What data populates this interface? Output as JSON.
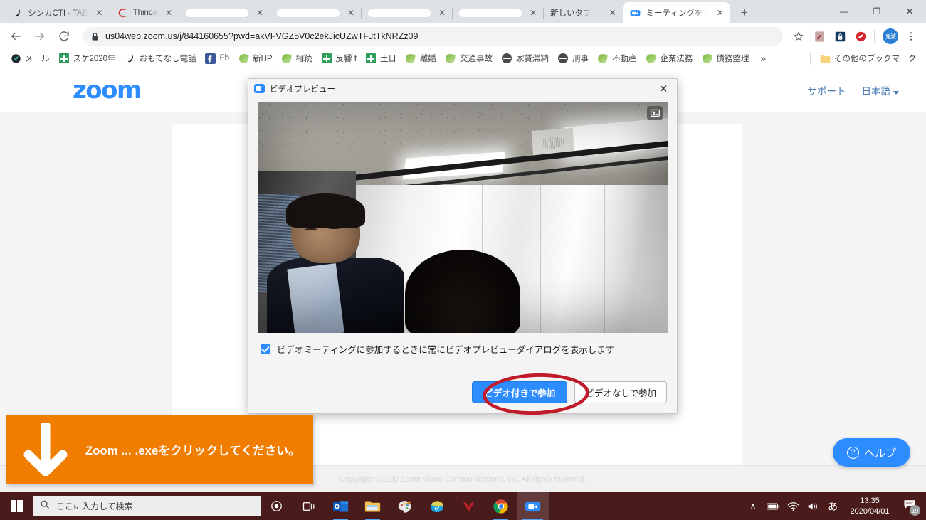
{
  "browser": {
    "tabs": [
      {
        "title": "シンカCTI - TAB",
        "favicon": "phone-icon",
        "redacted": false,
        "active": false
      },
      {
        "title": "Thinca",
        "favicon": "thinca-icon",
        "redacted": false,
        "active": false
      },
      {
        "title": "",
        "favicon": "blank-icon",
        "redacted": true,
        "active": false
      },
      {
        "title": "",
        "favicon": "blank-icon",
        "redacted": true,
        "active": false
      },
      {
        "title": "",
        "favicon": "blank-icon",
        "redacted": true,
        "active": false
      },
      {
        "title": "",
        "favicon": "blank-icon",
        "redacted": true,
        "active": false
      },
      {
        "title": "新しいタブ",
        "favicon": "newtab-icon",
        "redacted": false,
        "active": false
      },
      {
        "title": "ミーティングを立ち",
        "favicon": "zoom-icon",
        "redacted": false,
        "active": true
      }
    ],
    "new_tab_label": "+",
    "window_controls": {
      "minimize": "—",
      "maximize": "❐",
      "close": "✕"
    },
    "nav": {
      "back": "←",
      "forward": "→",
      "reload": "⟳"
    },
    "omnibox": {
      "url": "us04web.zoom.us/j/844160655?pwd=akVFVGZ5V0c2ekJicUZwTFJtTkNRZz09",
      "lock_icon": "lock-icon"
    },
    "toolbar_icons": [
      {
        "name": "bookmark-star-icon",
        "glyph": "☆"
      },
      {
        "name": "pdf-extension-icon",
        "glyph": "A"
      },
      {
        "name": "password-manager-icon",
        "glyph": "🔒"
      },
      {
        "name": "trend-micro-icon",
        "glyph": "●"
      }
    ],
    "profile_initials": "鬼滅",
    "menu_icon": "three-dot-menu-icon"
  },
  "bookmarks": {
    "items": [
      {
        "label": "メール",
        "icon": "dark-circle-icon"
      },
      {
        "label": "スケ2020年",
        "icon": "green-cross-icon"
      },
      {
        "label": "おもてなし電話",
        "icon": "phone-icon"
      },
      {
        "label": "Fb",
        "icon": "facebook-icon"
      },
      {
        "label": "新HP",
        "icon": "leaf-icon"
      },
      {
        "label": "相続",
        "icon": "leaf-icon"
      },
      {
        "label": "反響 f",
        "icon": "green-cross-icon"
      },
      {
        "label": "土日",
        "icon": "green-cross-icon"
      },
      {
        "label": "離婚",
        "icon": "leaf-icon"
      },
      {
        "label": "交通事故",
        "icon": "leaf-icon"
      },
      {
        "label": "家賃滞納",
        "icon": "globe-dark-icon"
      },
      {
        "label": "刑事",
        "icon": "globe-dark-icon"
      },
      {
        "label": "不動産",
        "icon": "leaf-icon"
      },
      {
        "label": "企業法務",
        "icon": "leaf-icon"
      },
      {
        "label": "債務整理",
        "icon": "leaf-icon"
      }
    ],
    "overflow_label": "»",
    "other_bookmarks": {
      "label": "その他のブックマーク",
      "icon": "folder-icon"
    }
  },
  "zoom_page": {
    "logo_text": "zoom",
    "nav": {
      "support_label": "サポート",
      "language_label": "日本語"
    },
    "help_button": {
      "label": "ヘルプ",
      "icon": "question-circle-icon"
    },
    "copyright": "Copyright ©2020 Zoom Video Communications, Inc. All rights reserved."
  },
  "dialog": {
    "title": "ビデオプレビュー",
    "title_icon": "zoom-app-icon",
    "close_label": "✕",
    "video": {
      "camera_badge_icon": "camera-image-icon",
      "alt": "エレベーター内の二人の人物のビデオプレビュー"
    },
    "checkbox": {
      "checked": true,
      "label": "ビデオミーティングに参加するときに常にビデオプレビューダイアログを表示します"
    },
    "buttons": {
      "join_with_video": "ビデオ付きで参加",
      "join_without_video": "ビデオなしで参加"
    },
    "annotation_circle_color": "#c01b2b"
  },
  "annotation": {
    "text": "Zoom ... .exeをクリックしてください。",
    "arrow_icon": "down-arrow-icon",
    "background_color": "#f07c00"
  },
  "taskbar": {
    "start_icon": "windows-logo-icon",
    "search_placeholder": "ここに入力して検索",
    "search_icon": "search-icon",
    "apps": [
      {
        "name": "cortana-icon",
        "glyph": "○"
      },
      {
        "name": "task-view-icon",
        "glyph": "❏"
      },
      {
        "name": "outlook-icon",
        "glyph": "O"
      },
      {
        "name": "file-explorer-icon",
        "glyph": "📁"
      },
      {
        "name": "paint-3d-icon",
        "glyph": "🎨"
      },
      {
        "name": "internet-explorer-icon",
        "glyph": "e"
      },
      {
        "name": "red-app-icon",
        "glyph": "T"
      },
      {
        "name": "chrome-icon",
        "glyph": "◍"
      },
      {
        "name": "zoom-icon",
        "glyph": "▣"
      }
    ],
    "tray": {
      "chevron": "∧",
      "battery_icon": "battery-icon",
      "wifi_icon": "wifi-icon",
      "volume_icon": "volume-icon",
      "ime_label": "あ",
      "time": "13:35",
      "date": "2020/04/01",
      "notification_count": "19",
      "notification_icon": "notification-icon"
    }
  }
}
